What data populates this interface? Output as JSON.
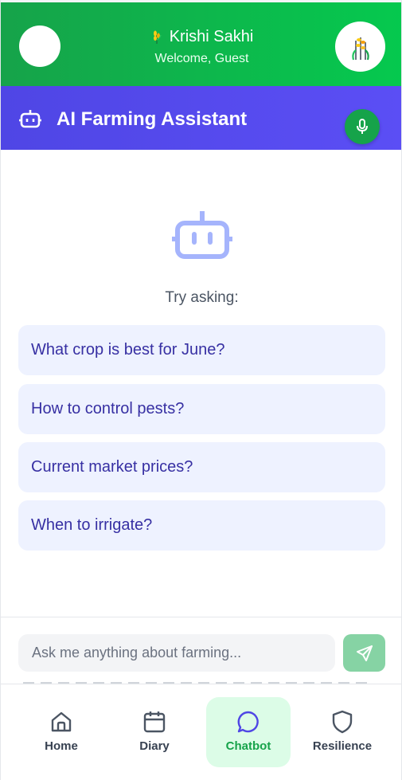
{
  "header": {
    "title": "Krishi Sakhi",
    "subtitle": "Welcome, Guest"
  },
  "assistant": {
    "title": "AI Farming Assistant",
    "icon": "robot-icon",
    "mic_icon": "microphone-icon"
  },
  "prompt": {
    "label": "Try asking:",
    "suggestions": [
      "What crop is best for June?",
      "How to control pests?",
      "Current market prices?",
      "When to irrigate?"
    ]
  },
  "input": {
    "placeholder": "Ask me anything about farming...",
    "send_icon": "send-icon"
  },
  "nav": {
    "items": [
      {
        "label": "Home",
        "icon": "home-icon"
      },
      {
        "label": "Diary",
        "icon": "calendar-icon"
      },
      {
        "label": "Chatbot",
        "icon": "chat-icon"
      },
      {
        "label": "Resilience",
        "icon": "shield-icon"
      }
    ],
    "active": "Chatbot"
  },
  "colors": {
    "header_green": "#16a34a",
    "assistant_indigo": "#4f46e5",
    "suggestion_bg": "#eef2ff",
    "suggestion_text": "#3730a3",
    "active_nav_bg": "#dcfce7"
  }
}
